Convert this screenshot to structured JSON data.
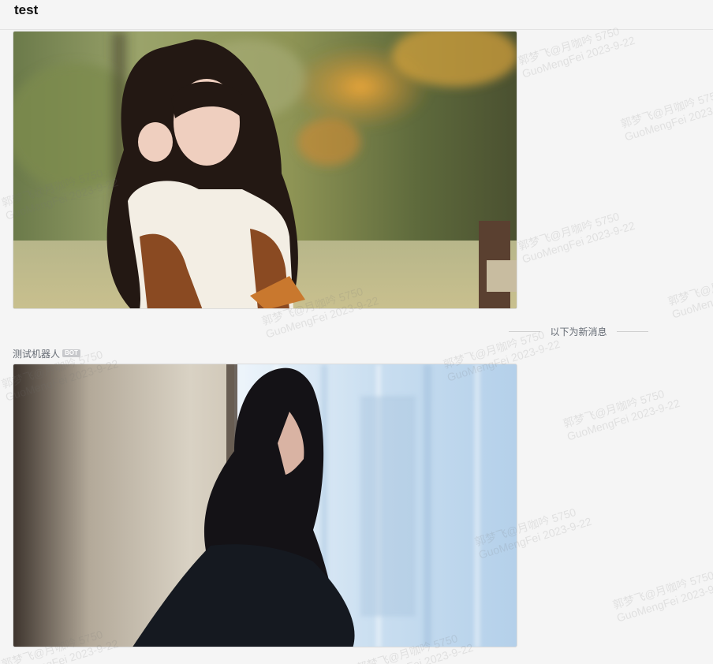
{
  "chat": {
    "title": "test"
  },
  "divider": {
    "text": "以下为新消息"
  },
  "message": {
    "sender": "测试机器人",
    "badge": "BOT"
  },
  "watermark": {
    "line1": "郭梦飞@月咖吟 5750",
    "line2": "GuoMengFei 2023-9-22"
  },
  "images": [
    {
      "description_icon": "photo-girl-autumn-icon"
    },
    {
      "description_icon": "photo-girl-window-icon"
    }
  ],
  "colors": {
    "background": "#f5f5f5",
    "divider_text": "#646a73",
    "badge_bg": "#c8c9cc"
  }
}
